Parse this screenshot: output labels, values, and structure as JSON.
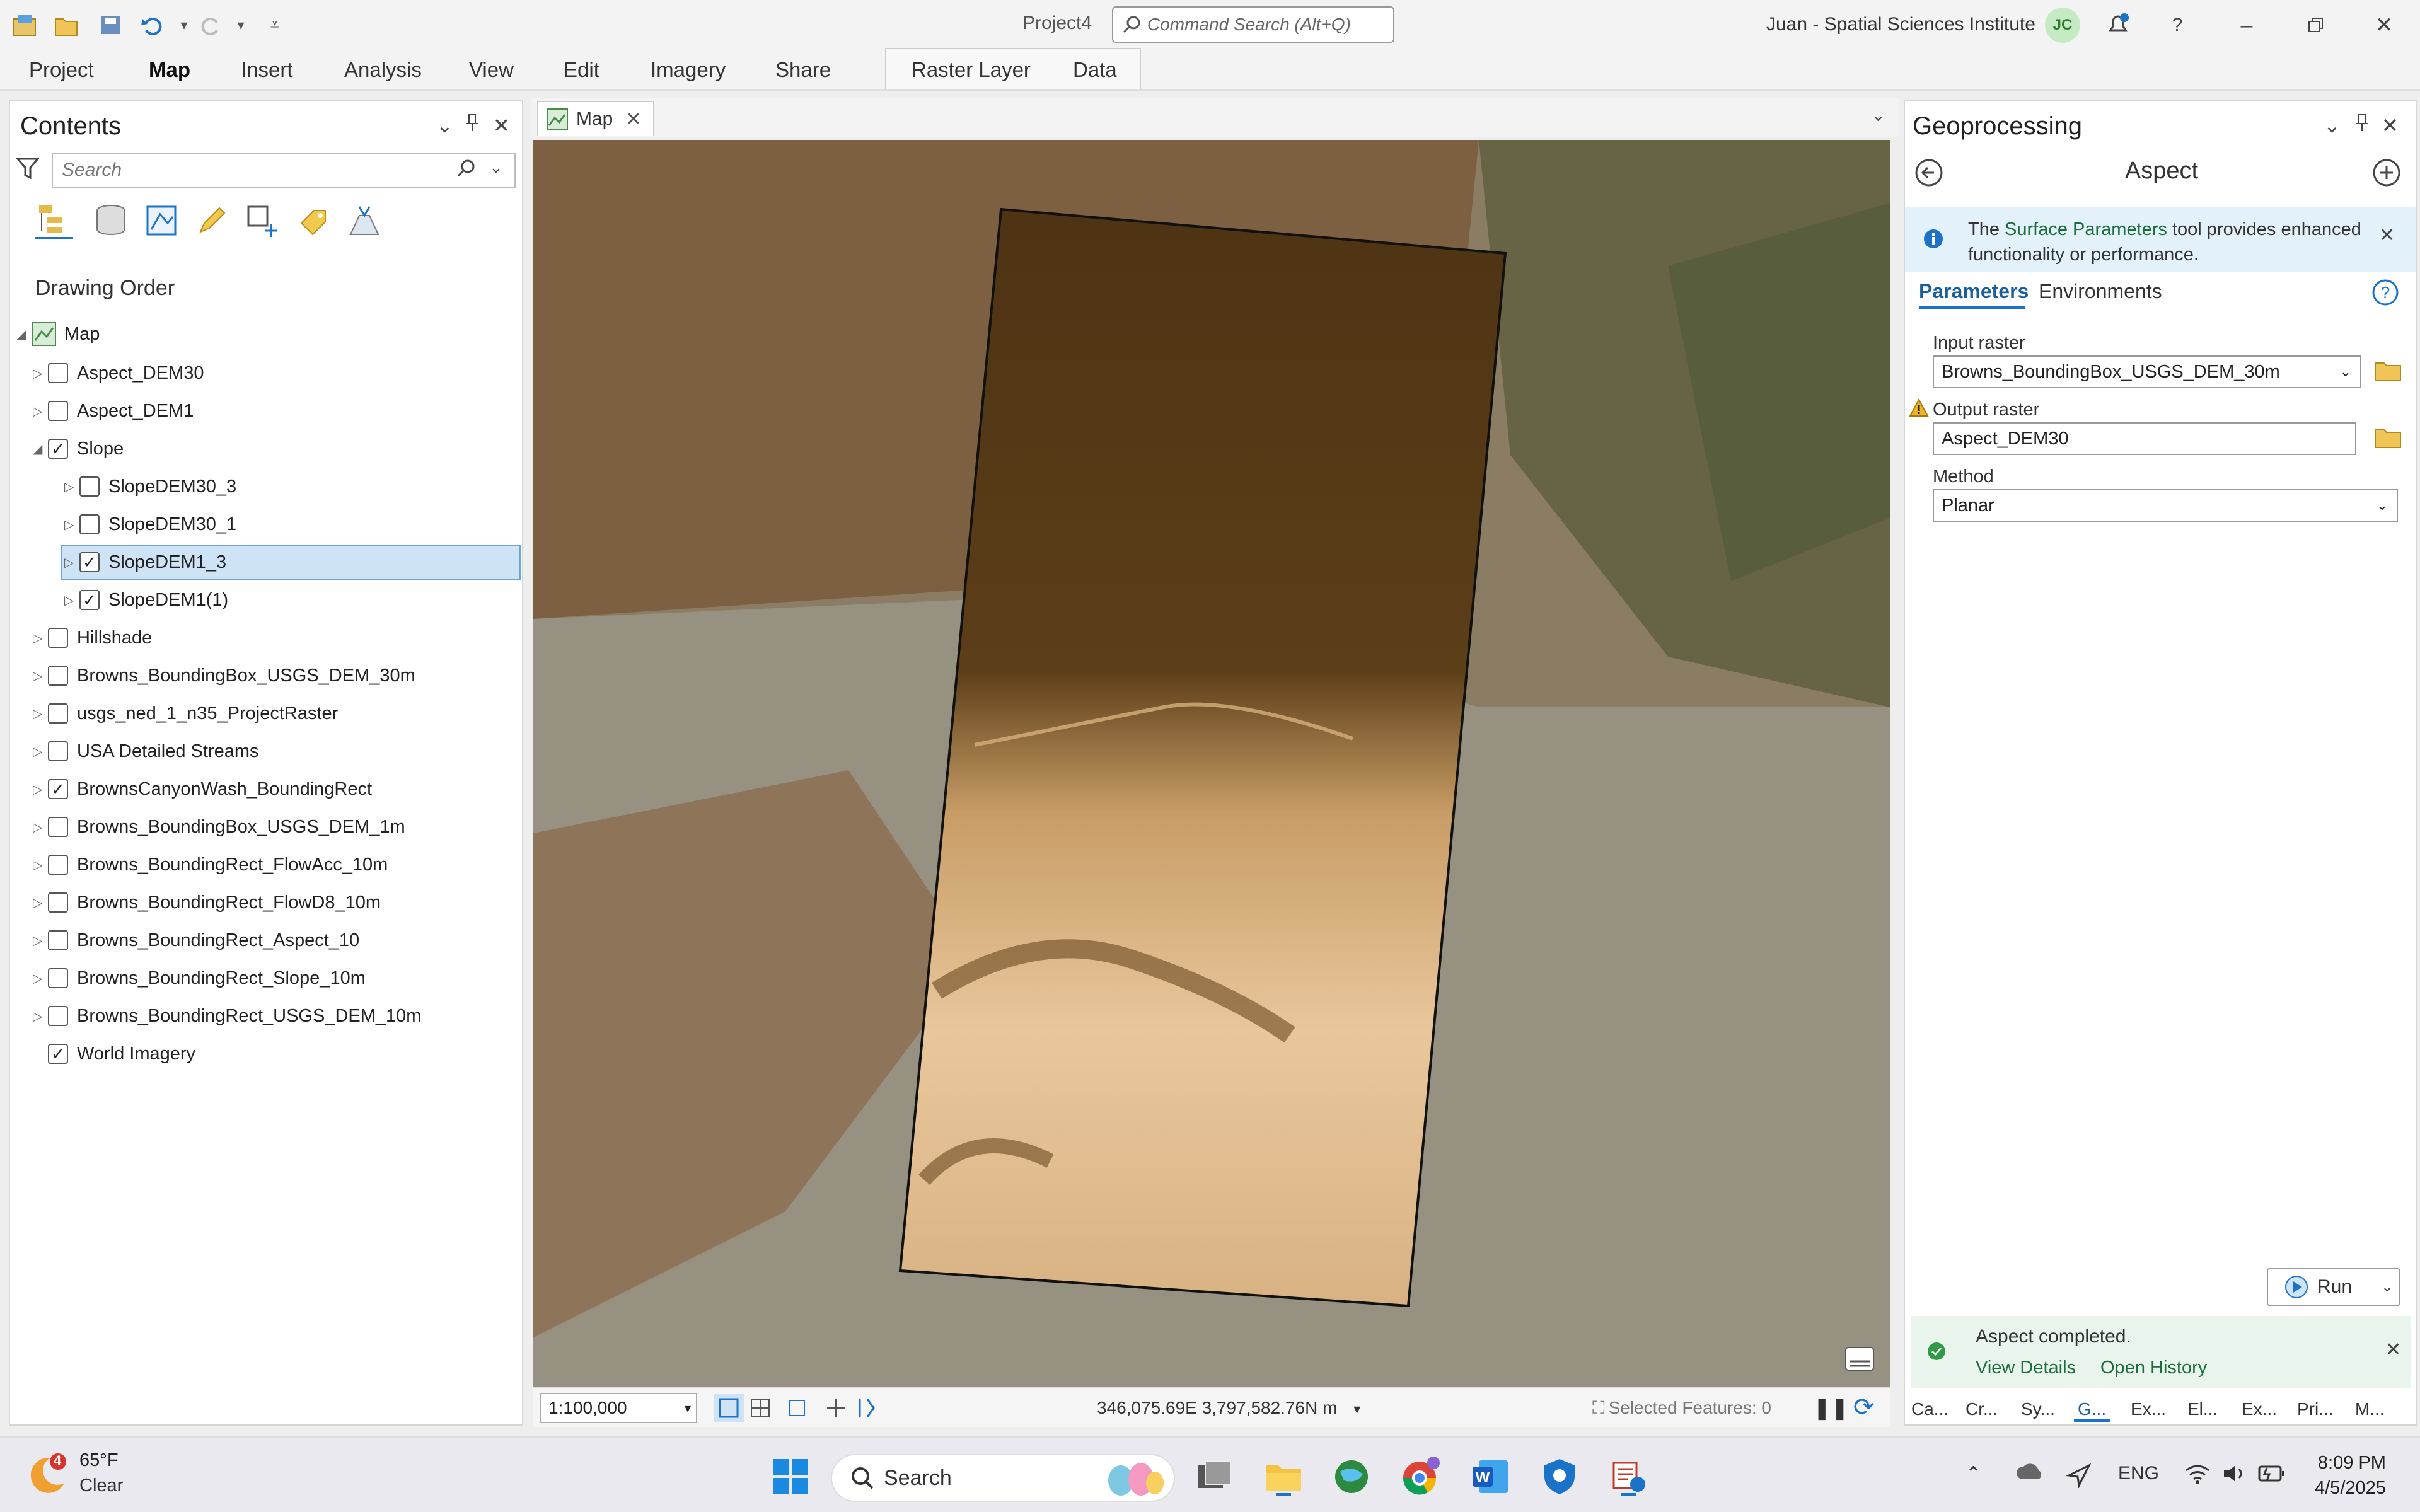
{
  "window": {
    "project_name": "Project4",
    "command_search_placeholder": "Command Search (Alt+Q)",
    "user": "Juan - Spatial Sciences Institute",
    "user_initials": "JC"
  },
  "ribbon": {
    "tabs": [
      "Project",
      "Map",
      "Insert",
      "Analysis",
      "View",
      "Edit",
      "Imagery",
      "Share"
    ],
    "active_tab": "Map",
    "contextual_tabs": [
      "Raster Layer",
      "Data"
    ]
  },
  "contents": {
    "title": "Contents",
    "search_placeholder": "Search",
    "section_title": "Drawing Order",
    "map_label": "Map",
    "layers": [
      {
        "name": "Aspect_DEM30",
        "checked": false,
        "indent": 0
      },
      {
        "name": "Aspect_DEM1",
        "checked": false,
        "indent": 0
      },
      {
        "name": "Slope",
        "checked": true,
        "indent": 0,
        "expanded": true
      },
      {
        "name": "SlopeDEM30_3",
        "checked": false,
        "indent": 1
      },
      {
        "name": "SlopeDEM30_1",
        "checked": false,
        "indent": 1
      },
      {
        "name": "SlopeDEM1_3",
        "checked": true,
        "indent": 1,
        "selected": true
      },
      {
        "name": "SlopeDEM1(1)",
        "checked": true,
        "indent": 1
      },
      {
        "name": "Hillshade",
        "checked": false,
        "indent": 0
      },
      {
        "name": "Browns_BoundingBox_USGS_DEM_30m",
        "checked": false,
        "indent": 0
      },
      {
        "name": "usgs_ned_1_n35_ProjectRaster",
        "checked": false,
        "indent": 0
      },
      {
        "name": "USA Detailed Streams",
        "checked": false,
        "indent": 0
      },
      {
        "name": "BrownsCanyonWash_BoundingRect",
        "checked": true,
        "indent": 0
      },
      {
        "name": "Browns_BoundingBox_USGS_DEM_1m",
        "checked": false,
        "indent": 0
      },
      {
        "name": "Browns_BoundingRect_FlowAcc_10m",
        "checked": false,
        "indent": 0
      },
      {
        "name": "Browns_BoundingRect_FlowD8_10m",
        "checked": false,
        "indent": 0
      },
      {
        "name": "Browns_BoundingRect_Aspect_10",
        "checked": false,
        "indent": 0
      },
      {
        "name": "Browns_BoundingRect_Slope_10m",
        "checked": false,
        "indent": 0
      },
      {
        "name": "Browns_BoundingRect_USGS_DEM_10m",
        "checked": false,
        "indent": 0
      },
      {
        "name": "World Imagery",
        "checked": true,
        "indent": 0,
        "no_expander": true
      }
    ]
  },
  "map": {
    "tab_label": "Map",
    "scale": "1:100,000",
    "coordinates": "346,075.69E 3,797,582.76N m",
    "selected_features": "Selected Features: 0"
  },
  "geoprocessing": {
    "title": "Geoprocessing",
    "tool_name": "Aspect",
    "info_pre": "The ",
    "info_link": "Surface Parameters",
    "info_post": " tool provides enhanced functionality or performance.",
    "tabs": [
      "Parameters",
      "Environments"
    ],
    "params": {
      "input_label": "Input raster",
      "input_value": "Browns_BoundingBox_USGS_DEM_30m",
      "output_label": "Output raster",
      "output_value": "Aspect_DEM30",
      "method_label": "Method",
      "method_value": "Planar"
    },
    "run_label": "Run",
    "success_message": "Aspect completed.",
    "view_details": "View Details",
    "open_history": "Open History",
    "bottom_tabs": [
      "Ca...",
      "Cr...",
      "Sy...",
      "G...",
      "Ex...",
      "El...",
      "Ex...",
      "Pri...",
      "M..."
    ]
  },
  "taskbar": {
    "weather_temp": "65°F",
    "weather_desc": "Clear",
    "weather_badge": "4",
    "search_label": "Search",
    "language": "ENG",
    "time": "8:09 PM",
    "date": "4/5/2025"
  },
  "colors": {
    "accent": "#1a73c8",
    "slope_dark": "#4e3414",
    "slope_light": "#e9c79c",
    "success_green": "#2e9b48"
  }
}
